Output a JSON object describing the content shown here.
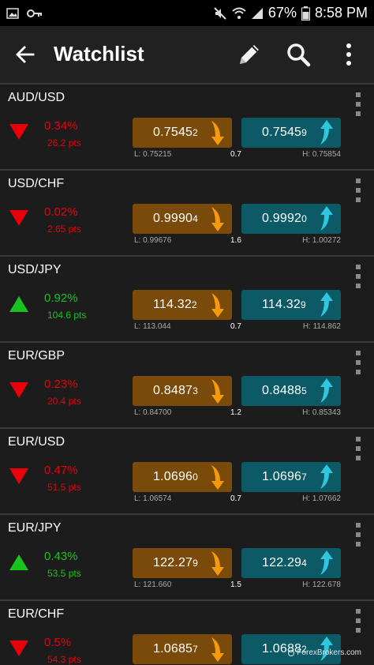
{
  "status_bar": {
    "battery": "67%",
    "time": "8:58 PM",
    "icons": [
      "image-icon",
      "key-icon",
      "mute-icon",
      "wifi-icon",
      "signal-icon",
      "battery-icon"
    ]
  },
  "app_bar": {
    "title": "Watchlist",
    "icons": [
      "back-arrow-icon",
      "pencil-icon",
      "search-icon",
      "overflow-menu-icon"
    ]
  },
  "colors": {
    "negative": "#e8000b",
    "positive": "#19c31e",
    "sell_bg": "#7a4a0a",
    "buy_bg": "#0b5a66",
    "sell_arrow": "#f59a0c",
    "buy_arrow": "#2fc6df"
  },
  "rows": [
    {
      "pair": "AUD/USD",
      "direction": "down",
      "change_pct": "0.34%",
      "change_pts": "26.2 pts",
      "sell": {
        "price": "0.7545",
        "pip": "2"
      },
      "buy": {
        "price": "0.7545",
        "pip": "9"
      },
      "low": "L: 0.75215",
      "spread": "0.7",
      "high": "H: 0.75854"
    },
    {
      "pair": "USD/CHF",
      "direction": "down",
      "change_pct": "0.02%",
      "change_pts": "2.65 pts",
      "sell": {
        "price": "0.9990",
        "pip": "4"
      },
      "buy": {
        "price": "0.9992",
        "pip": "0"
      },
      "low": "L: 0.99676",
      "spread": "1.6",
      "high": "H: 1.00272"
    },
    {
      "pair": "USD/JPY",
      "direction": "up",
      "change_pct": "0.92%",
      "change_pts": "104.6 pts",
      "sell": {
        "price": "114.32",
        "pip": "2"
      },
      "buy": {
        "price": "114.32",
        "pip": "9"
      },
      "low": "L: 113.044",
      "spread": "0.7",
      "high": "H: 114.862"
    },
    {
      "pair": "EUR/GBP",
      "direction": "down",
      "change_pct": "0.23%",
      "change_pts": "20.4 pts",
      "sell": {
        "price": "0.8487",
        "pip": "3"
      },
      "buy": {
        "price": "0.8488",
        "pip": "5"
      },
      "low": "L: 0.84700",
      "spread": "1.2",
      "high": "H: 0.85343"
    },
    {
      "pair": "EUR/USD",
      "direction": "down",
      "change_pct": "0.47%",
      "change_pts": "51.5 pts",
      "sell": {
        "price": "1.0696",
        "pip": "0"
      },
      "buy": {
        "price": "1.0696",
        "pip": "7"
      },
      "low": "L: 1.06574",
      "spread": "0.7",
      "high": "H: 1.07662"
    },
    {
      "pair": "EUR/JPY",
      "direction": "up",
      "change_pct": "0.43%",
      "change_pts": "53.5 pts",
      "sell": {
        "price": "122.27",
        "pip": "9"
      },
      "buy": {
        "price": "122.29",
        "pip": "4"
      },
      "low": "L: 121.660",
      "spread": "1.5",
      "high": "H: 122.678"
    },
    {
      "pair": "EUR/CHF",
      "direction": "down",
      "change_pct": "0.5%",
      "change_pts": "54.3 pts",
      "sell": {
        "price": "1.0685",
        "pip": "7"
      },
      "buy": {
        "price": "1.0688",
        "pip": "2"
      },
      "low": "",
      "spread": "",
      "high": ""
    }
  ],
  "watermark": "ForexBrokers.com"
}
